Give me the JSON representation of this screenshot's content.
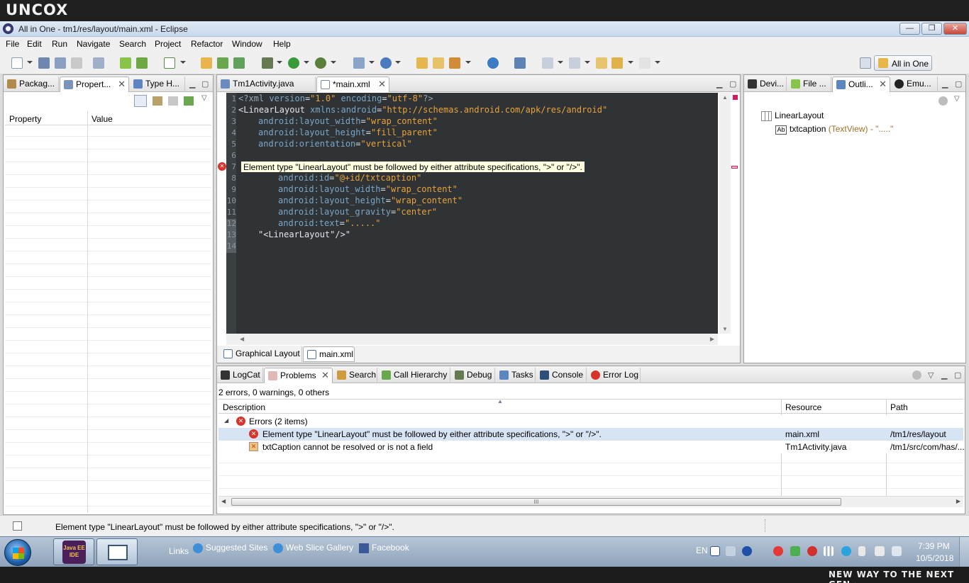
{
  "brand": {
    "logo": "UNCOX",
    "tagline": "NEW WAY TO THE NEXT GEN ›"
  },
  "window": {
    "title": "All in One - tm1/res/layout/main.xml - Eclipse",
    "buttons": {
      "minimize": "—",
      "maximize": "❐",
      "close": "✕"
    }
  },
  "menu": [
    "File",
    "Edit",
    "Run",
    "Navigate",
    "Search",
    "Project",
    "Refactor",
    "Window",
    "Help"
  ],
  "perspective": {
    "label": "All in One"
  },
  "left_panel": {
    "tabs": [
      {
        "label": "Packag..."
      },
      {
        "label": "Propert..."
      },
      {
        "label": "Type H..."
      }
    ],
    "headers": {
      "property": "Property",
      "value": "Value"
    }
  },
  "editor": {
    "tabs": [
      {
        "label": "Tm1Activity.java"
      },
      {
        "label": "*main.xml"
      }
    ],
    "bottom_tabs": [
      {
        "label": "Graphical Layout"
      },
      {
        "label": "main.xml"
      }
    ],
    "tooltip": "Element type \"LinearLayout\" must be followed by either attribute specifications, \">\" or \"/>\".",
    "line_numbers": [
      "1",
      "2",
      "3",
      "4",
      "5",
      "6",
      "7",
      "8",
      "9",
      "10",
      "11",
      "12",
      "13",
      "14"
    ],
    "lines": {
      "l1": {
        "a": "<?xml ",
        "b": "version",
        "c": "=",
        "d": "\"1.0\"",
        "e": " encoding",
        "f": "=",
        "g": "\"utf-8\"",
        "h": "?>"
      },
      "l2": {
        "a": "<LinearLayout ",
        "b": "xmlns:android",
        "c": "=",
        "d": "\"http://schemas.android.com/apk/res/android\""
      },
      "l3": {
        "b": "android:layout_width",
        "c": "=",
        "d": "\"wrap_content\""
      },
      "l4": {
        "b": "android:layout_height",
        "c": "=",
        "d": "\"fill_parent\""
      },
      "l5": {
        "b": "android:orientation",
        "c": "=",
        "d": "\"vertical\""
      },
      "l8": {
        "b": "android:id",
        "c": "=",
        "d": "\"@+id/txtcaption\""
      },
      "l9": {
        "b": "android:layout_width",
        "c": "=",
        "d": "\"wrap_content\""
      },
      "l10": {
        "b": "android:layout_height",
        "c": "=",
        "d": "\"wrap_content\""
      },
      "l11": {
        "b": "android:layout_gravity",
        "c": "=",
        "d": "\"center\""
      },
      "l12": {
        "b": "android:text",
        "c": "=",
        "d": "\".....\""
      },
      "l13": {
        "a": "\"<LinearLayout\"/>\""
      }
    }
  },
  "right_panel": {
    "tabs": [
      {
        "label": "Devi..."
      },
      {
        "label": "File ..."
      },
      {
        "label": "Outli..."
      },
      {
        "label": "Emu..."
      }
    ],
    "outline": {
      "root": "LinearLayout",
      "child_icon": "Ab",
      "child_name": "txtcaption",
      "child_type": " (TextView)",
      "child_text": " - \".....\""
    }
  },
  "bottom_panel": {
    "tabs": [
      {
        "label": "LogCat"
      },
      {
        "label": "Problems"
      },
      {
        "label": "Search"
      },
      {
        "label": "Call Hierarchy"
      },
      {
        "label": "Debug"
      },
      {
        "label": "Tasks"
      },
      {
        "label": "Console"
      },
      {
        "label": "Error Log"
      }
    ],
    "summary": "2 errors, 0 warnings, 0 others",
    "columns": {
      "description": "Description",
      "resource": "Resource",
      "path": "Path"
    },
    "group": "Errors (2 items)",
    "rows": [
      {
        "description": "Element type \"LinearLayout\" must be followed by either attribute specifications, \">\" or \"/>\".",
        "resource": "main.xml",
        "path": "/tm1/res/layout"
      },
      {
        "description": "txtCaption cannot be resolved or is not a field",
        "resource": "Tm1Activity.java",
        "path": "/tm1/src/com/has/..."
      }
    ],
    "scroll_grip": "III"
  },
  "status": {
    "message": "Element type \"LinearLayout\" must be followed by either attribute specifications, \">\" or \"/>\"."
  },
  "taskbar": {
    "links_label": "Links",
    "links": [
      {
        "label": "Suggested Sites"
      },
      {
        "label": "Web Slice Gallery"
      },
      {
        "label": "Facebook"
      }
    ],
    "lang": "EN",
    "time": "7:39 PM",
    "date": "10/5/2018",
    "app_badge": "Java EE IDE"
  },
  "colors": {
    "accent": "#3c6ea8",
    "error": "#d9342b",
    "editor_bg": "#2f3335"
  }
}
